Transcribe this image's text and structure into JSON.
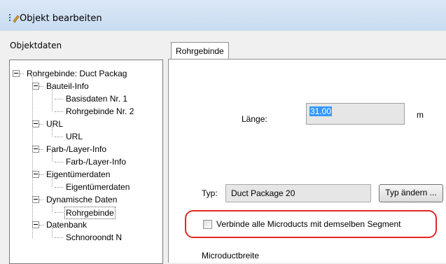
{
  "window": {
    "title": "Objekt bearbeiten",
    "title_icon": "edit-object-icon"
  },
  "left_panel": {
    "label": "Objektdaten",
    "tree": [
      {
        "label": "Rohrgebinde: Duct Packag",
        "level": 0,
        "expander": true
      },
      {
        "label": "Bauteil-Info",
        "level": 1,
        "expander": true
      },
      {
        "label": "Basisdaten Nr. 1",
        "level": 2,
        "expander": false
      },
      {
        "label": "Rohrgebinde Nr. 2",
        "level": 2,
        "expander": false
      },
      {
        "label": "URL",
        "level": 1,
        "expander": true
      },
      {
        "label": "URL",
        "level": 2,
        "expander": false
      },
      {
        "label": "Farb-/Layer-Info",
        "level": 1,
        "expander": true
      },
      {
        "label": "Farb-/Layer-Info",
        "level": 2,
        "expander": false
      },
      {
        "label": "Eigentümerdaten",
        "level": 1,
        "expander": true
      },
      {
        "label": "Eigentümerdaten",
        "level": 2,
        "expander": false
      },
      {
        "label": "Dynamische Daten",
        "level": 1,
        "expander": true
      },
      {
        "label": "Rohrgebinde",
        "level": 2,
        "expander": false,
        "selected": true
      },
      {
        "label": "Datenbank",
        "level": 1,
        "expander": true
      },
      {
        "label": "Schnoroondt N",
        "level": 2,
        "expander": false
      }
    ]
  },
  "tabs": [
    {
      "label": "Rohrgebinde",
      "active": true
    }
  ],
  "form": {
    "length_label": "Länge:",
    "length_value": "31.00",
    "length_unit": "m",
    "type_label": "Typ:",
    "type_value": "Duct Package 20",
    "change_type_button": "Typ ändern ...",
    "checkbox_label": "Verbinde alle Microducts mit demselben Segment",
    "checkbox_checked": false,
    "cut_off_label": "Microductbreite"
  },
  "colors": {
    "highlight": "#e32626",
    "selection": "#3399ff"
  }
}
